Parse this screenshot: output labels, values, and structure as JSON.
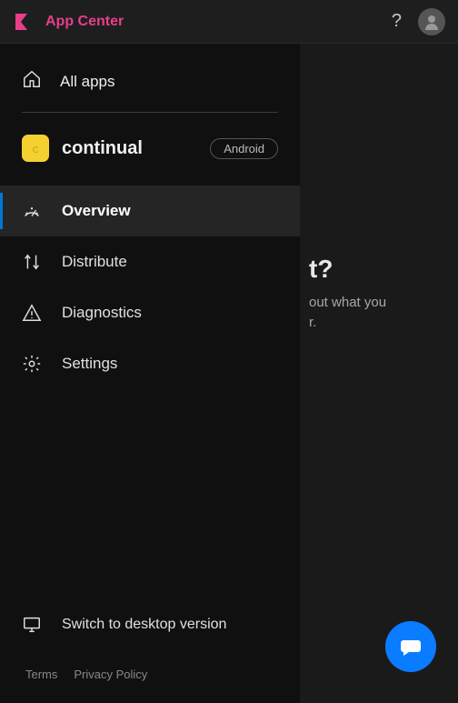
{
  "header": {
    "brand": "App Center",
    "help_aria": "Help"
  },
  "sidebar": {
    "all_apps": "All apps",
    "app": {
      "initial": "c",
      "name": "continual",
      "platform": "Android"
    },
    "nav": [
      {
        "label": "Overview",
        "active": true
      },
      {
        "label": "Distribute",
        "active": false
      },
      {
        "label": "Diagnostics",
        "active": false
      },
      {
        "label": "Settings",
        "active": false
      }
    ],
    "switch_desktop": "Switch to desktop version",
    "footer": {
      "terms": "Terms",
      "privacy": "Privacy Policy"
    }
  },
  "main": {
    "heading_fragment": "t?",
    "line1_fragment": "out what you",
    "line2_fragment": "r."
  }
}
